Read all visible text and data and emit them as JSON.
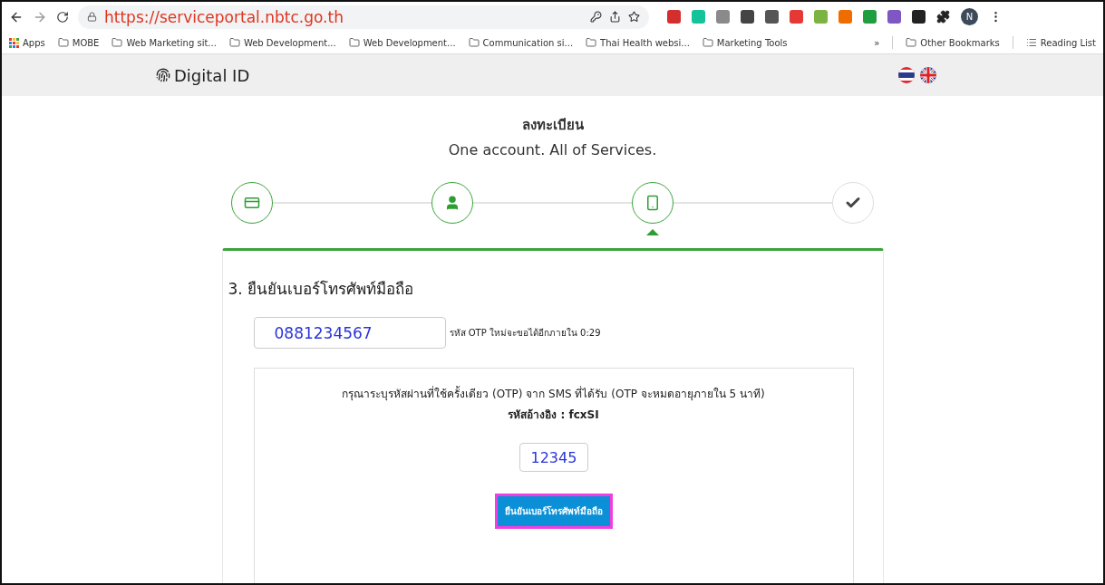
{
  "browser": {
    "url": "https://serviceportal.nbtc.go.th",
    "profile_initial": "N",
    "extensions": [
      {
        "color": "#d32f2f"
      },
      {
        "color": "#15c39a"
      },
      {
        "color": "#8a8a8a"
      },
      {
        "color": "#444444"
      },
      {
        "color": "#555555"
      },
      {
        "color": "#e53935"
      },
      {
        "color": "#7cb342"
      },
      {
        "color": "#ef6c00"
      },
      {
        "color": "#1e9e3e"
      },
      {
        "color": "#7e57c2"
      },
      {
        "color": "#222222"
      }
    ],
    "bookmarks": [
      {
        "label": "Apps",
        "kind": "apps"
      },
      {
        "label": "MOBE",
        "kind": "folder"
      },
      {
        "label": "Web Marketing sit...",
        "kind": "folder"
      },
      {
        "label": "Web Development...",
        "kind": "folder"
      },
      {
        "label": "Web Development...",
        "kind": "folder"
      },
      {
        "label": "Communication si...",
        "kind": "folder"
      },
      {
        "label": "Thai Health websi...",
        "kind": "folder"
      },
      {
        "label": "Marketing Tools",
        "kind": "folder"
      }
    ],
    "overflow": "»",
    "other_bookmarks": "Other Bookmarks",
    "reading_list": "Reading List"
  },
  "header": {
    "brand": "Digital ID",
    "languages": [
      {
        "kind": "thai"
      },
      {
        "kind": "uk"
      }
    ]
  },
  "page": {
    "title": "ลงทะเบียน",
    "subtitle": "One account. All of Services.",
    "steps": [
      {
        "kind": "card",
        "done": true,
        "selected": false
      },
      {
        "kind": "person",
        "done": true,
        "selected": false
      },
      {
        "kind": "phone",
        "done": true,
        "selected": true
      },
      {
        "kind": "check",
        "done": false,
        "selected": false
      }
    ],
    "section_title": "3. ยืนยันเบอร์โทรศัพท์มือถือ",
    "phone": {
      "value": "0881234567"
    },
    "resend_note": "รหัส OTP ใหม่จะขอได้อีกภายใน 0:29",
    "otp_box": {
      "instruction": "กรุณาระบุรหัสผ่านที่ใช้ครั้งเดียว (OTP) จาก SMS ที่ได้รับ (OTP จะหมดอายุภายใน 5 นาที)",
      "reference": "รหัสอ้างอิง : fcxSI",
      "otp": {
        "value": "12345"
      },
      "submit": "ยืนยันเบอร์โทรศัพท์มือถือ"
    }
  }
}
